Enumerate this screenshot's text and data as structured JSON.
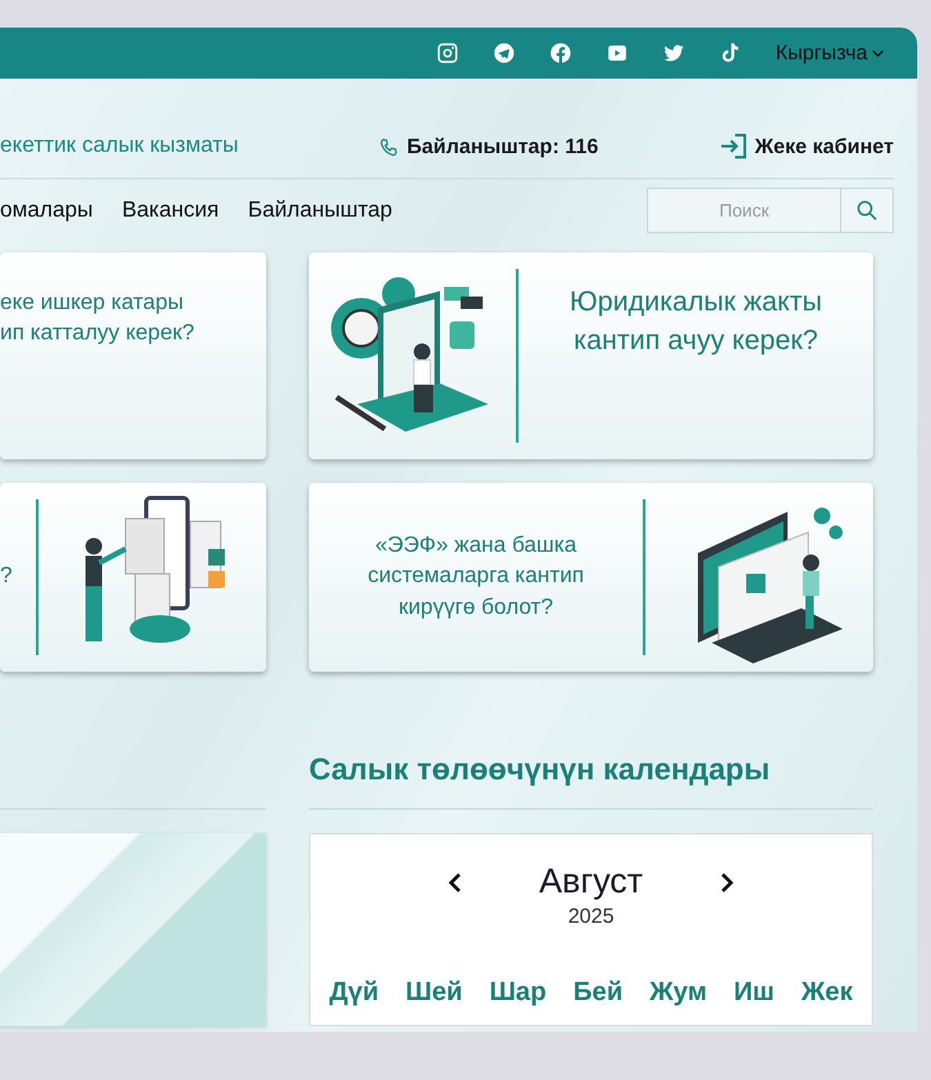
{
  "top_bar": {
    "language": "Кыргызча"
  },
  "header": {
    "site_name": "екеттик салык кызматы",
    "contact": "Байланыштар: 116",
    "cabinet": "Жеке кабинет"
  },
  "nav": {
    "items": [
      "омалары",
      "Вакансия",
      "Байланыштар"
    ],
    "search": {
      "placeholder": "Поиск"
    }
  },
  "cards": [
    {
      "kind": "text",
      "text": "еке ишкер катары\nип катталуу керек?"
    },
    {
      "kind": "image-text",
      "text": "Юридикалык жакты\nкантип ачуу керек?"
    },
    {
      "kind": "text-image",
      "text": "?"
    },
    {
      "kind": "text-image",
      "text": "«ЭЭФ» жана башка\nсистемаларга кантип\nкирүүгө болот?"
    }
  ],
  "calendar": {
    "title": "Салык төлөөчүнүн календары",
    "month": "Август",
    "year": "2025",
    "weekdays": [
      "Дүй",
      "Шей",
      "Шар",
      "Бей",
      "Жум",
      "Иш",
      "Жек"
    ]
  }
}
